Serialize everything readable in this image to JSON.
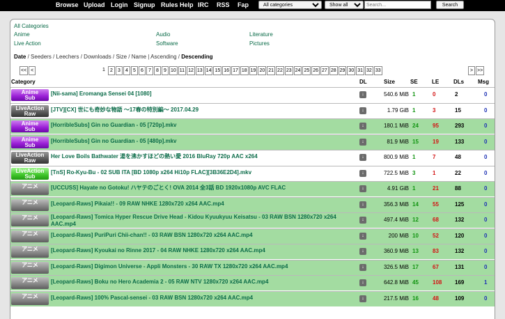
{
  "nav": {
    "items": [
      "Browse",
      "Upload",
      "Login",
      "Signup",
      "Rules Help",
      "IRC",
      "RSS",
      "Fap"
    ],
    "category_select": "All categories",
    "filter_select": "Show all",
    "search_placeholder": "Search...",
    "search_button": "Search"
  },
  "categories": {
    "all": "All Categories",
    "anime": "Anime",
    "live_action": "Live Action",
    "audio": "Audio",
    "software": "Software",
    "literature": "Literature",
    "pictures": "Pictures"
  },
  "sort": {
    "date": "Date",
    "seeders": "Seeders",
    "leechers": "Leechers",
    "downloads": "Downloads",
    "size": "Size",
    "name": "Name",
    "ascending": "Ascending",
    "descending": "Descending",
    "sep": "/",
    "bar": "|"
  },
  "pager": {
    "first": "<<",
    "prev": "<",
    "next": ">",
    "last": ">>",
    "pages": [
      "1",
      "2",
      "3",
      "4",
      "5",
      "6",
      "7",
      "8",
      "9",
      "10",
      "11",
      "12",
      "13",
      "14",
      "15",
      "16",
      "17",
      "18",
      "19",
      "20",
      "21",
      "22",
      "23",
      "24",
      "25",
      "26",
      "27",
      "28",
      "29",
      "30",
      "31",
      "32",
      "33"
    ]
  },
  "table": {
    "headers": {
      "category": "Category",
      "dl": "DL",
      "size": "Size",
      "se": "SE",
      "le": "LE",
      "dls": "DLs",
      "msg": "Msg"
    },
    "rows": [
      {
        "cat_l1": "Anime",
        "cat_l2": "Sub",
        "cat_class": "anime-sub",
        "title": "[Nii-sama] Eromanga Sensei 04 [1080]",
        "size": "540.6 MiB",
        "se": "1",
        "le": "0",
        "dls": "2",
        "msg": "0",
        "green": false
      },
      {
        "cat_l1": "LiveAction",
        "cat_l2": "Raw",
        "cat_class": "live-raw",
        "title": "[JTV][CX] 世にも奇妙な物語 ～17春の特別編～ 2017.04.29",
        "size": "1.79 GiB",
        "se": "1",
        "le": "3",
        "dls": "15",
        "msg": "0",
        "green": false
      },
      {
        "cat_l1": "Anime",
        "cat_l2": "Sub",
        "cat_class": "anime-sub",
        "title": "[HorribleSubs] Gin no Guardian - 05 [720p].mkv",
        "size": "180.1 MiB",
        "se": "24",
        "le": "95",
        "dls": "293",
        "msg": "0",
        "green": true
      },
      {
        "cat_l1": "Anime",
        "cat_l2": "Sub",
        "cat_class": "anime-sub",
        "title": "[HorribleSubs] Gin no Guardian - 05 [480p].mkv",
        "size": "81.9 MiB",
        "se": "15",
        "le": "19",
        "dls": "133",
        "msg": "0",
        "green": true
      },
      {
        "cat_l1": "LiveAction",
        "cat_l2": "Raw",
        "cat_class": "live-raw",
        "title": "Her Love Boils Bathwater 湯を沸かすほどの熱い愛 2016 BluRay 720p AAC x264",
        "size": "800.9 MiB",
        "se": "1",
        "le": "7",
        "dls": "48",
        "msg": "0",
        "green": false
      },
      {
        "cat_l1": "LiveAction",
        "cat_l2": "Sub",
        "cat_class": "live-sub",
        "title": "[TnS] Ro-Kyu-Bu - 02 SUB ITA [BD 1080p x264 Hi10p FLAC][3B36E2D4].mkv",
        "size": "722.5 MiB",
        "se": "3",
        "le": "1",
        "dls": "22",
        "msg": "0",
        "green": false
      },
      {
        "cat_l1": "アニメ",
        "cat_l2": "",
        "cat_class": "anime-raw",
        "title": "[UCCUSS] Hayate no Gotoku! ハヤテのごとく! OVA 2014 全3話 BD 1920x1080p AVC FLAC",
        "size": "4.91 GiB",
        "se": "1",
        "le": "21",
        "dls": "88",
        "msg": "0",
        "green": true
      },
      {
        "cat_l1": "アニメ",
        "cat_l2": "",
        "cat_class": "anime-raw",
        "title": "[Leopard-Raws] Pikaia!! - 09 RAW NHKE 1280x720 x264 AAC.mp4",
        "size": "356.3 MiB",
        "se": "14",
        "le": "55",
        "dls": "125",
        "msg": "0",
        "green": true
      },
      {
        "cat_l1": "アニメ",
        "cat_l2": "",
        "cat_class": "anime-raw",
        "title": "[Leopard-Raws] Tomica Hyper Rescue Drive Head - Kidou Kyuukyuu Keisatsu - 03 RAW BSN 1280x720 x264 AAC.mp4",
        "size": "497.4 MiB",
        "se": "12",
        "le": "68",
        "dls": "132",
        "msg": "0",
        "green": true,
        "two": true
      },
      {
        "cat_l1": "アニメ",
        "cat_l2": "",
        "cat_class": "anime-raw",
        "title": "[Leopard-Raws] PuriPuri Chii-chan!! - 03 RAW BSN 1280x720 x264 AAC.mp4",
        "size": "200 MiB",
        "se": "10",
        "le": "52",
        "dls": "120",
        "msg": "0",
        "green": true
      },
      {
        "cat_l1": "アニメ",
        "cat_l2": "",
        "cat_class": "anime-raw",
        "title": "[Leopard-Raws] Kyoukai no Rinne 2017 - 04 RAW NHKE 1280x720 x264 AAC.mp4",
        "size": "360.9 MiB",
        "se": "13",
        "le": "83",
        "dls": "132",
        "msg": "0",
        "green": true
      },
      {
        "cat_l1": "アニメ",
        "cat_l2": "",
        "cat_class": "anime-raw",
        "title": "[Leopard-Raws] Digimon Universe - Appli Monsters - 30 RAW TX 1280x720 x264 AAC.mp4",
        "size": "326.5 MiB",
        "se": "17",
        "le": "67",
        "dls": "131",
        "msg": "0",
        "green": true
      },
      {
        "cat_l1": "アニメ",
        "cat_l2": "",
        "cat_class": "anime-raw",
        "title": "[Leopard-Raws] Boku no Hero Academia 2 - 05 RAW NTV 1280x720 x264 AAC.mp4",
        "size": "642.8 MiB",
        "se": "45",
        "le": "108",
        "dls": "169",
        "msg": "1",
        "green": true
      },
      {
        "cat_l1": "アニメ",
        "cat_l2": "",
        "cat_class": "anime-raw",
        "title": "[Leopard-Raws] 100% Pascal-sensei - 03 RAW BSN 1280x720 x264 AAC.mp4",
        "size": "217.5 MiB",
        "se": "16",
        "le": "48",
        "dls": "109",
        "msg": "0",
        "green": true
      }
    ]
  },
  "icons": {
    "download": "download-arrow-icon"
  },
  "colors": {
    "link_green": "#0a6b48",
    "row_green": "#a3dca1",
    "seed_green": "#119411",
    "leech_red": "#d31313",
    "msg_blue": "#1c30b3"
  }
}
